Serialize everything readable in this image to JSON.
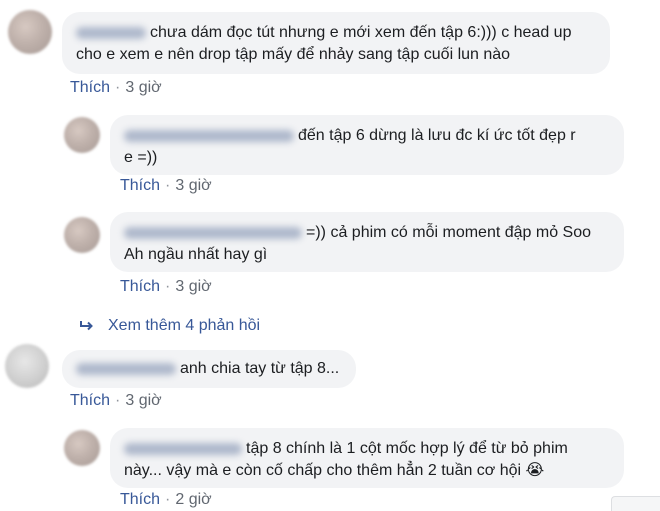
{
  "comments": [
    {
      "text": "chưa dám đọc tút nhưng e mới xem đến tập 6:))) c head up cho e xem e nên drop tập mấy để nhảy sang tập cuối lun nào",
      "line1": "chưa dám đọc tút nhưng e mới xem đến tập 6:))) c head up",
      "line2": "cho e xem e nên drop tập mấy để nhảy sang tập cuối lun nào",
      "like": "Thích",
      "dot": "·",
      "time": "3 giờ"
    },
    {
      "text": "đến tập 6 dừng là lưu đc kí ức tốt đẹp r e =))",
      "line1": "đến tập 6 dừng là lưu đc kí ức tốt đẹp r",
      "line2": "e =))",
      "like": "Thích",
      "dot": "·",
      "time": "3 giờ"
    },
    {
      "text": "=)) cả phim có mỗi moment đập mỏ Soo Ah ngầu nhất hay gì",
      "line1": "=)) cả phim có mỗi moment đập mỏ Soo",
      "line2": "Ah ngầu nhất hay gì",
      "like": "Thích",
      "dot": "·",
      "time": "3 giờ"
    },
    {
      "text": "anh chia tay từ tập 8...",
      "line1": "anh chia tay từ tập 8...",
      "like": "Thích",
      "dot": "·",
      "time": "3 giờ"
    },
    {
      "text": "tập 8 chính là 1 cột mốc hợp lý để từ bỏ phim này... vậy mà e còn cố chấp cho thêm hẳn 2 tuần cơ hội 😭",
      "line1": "tập 8 chính là 1 cột mốc hợp lý để từ bỏ phim",
      "line2": "này... vậy mà e còn cố chấp cho thêm hẳn 2 tuần cơ hội",
      "emoji": "😭",
      "like": "Thích",
      "dot": "·",
      "time": "2 giờ"
    }
  ],
  "view_more_replies": "Xem thêm 4 phản hồi",
  "icons": {
    "reply_arrow": "reply-arrow-icon"
  },
  "colors": {
    "link": "#385898",
    "bubble": "#f2f3f5",
    "meta": "#616770"
  }
}
